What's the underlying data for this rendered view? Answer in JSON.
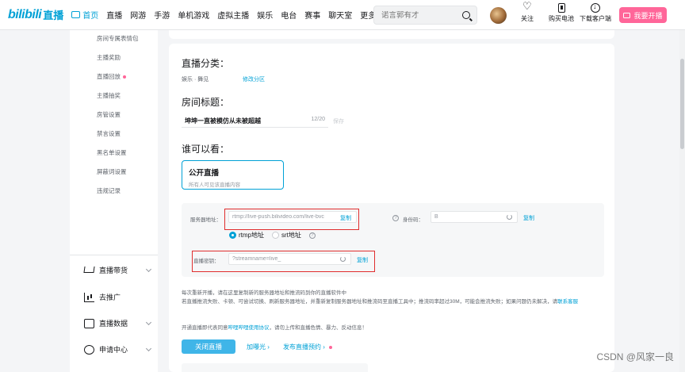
{
  "header": {
    "logo_mark": "bilibili",
    "logo_live": "直播",
    "nav": [
      "首页",
      "直播",
      "网游",
      "手游",
      "单机游戏",
      "虚拟主播",
      "娱乐",
      "电台",
      "赛事",
      "聊天室",
      "更多"
    ],
    "search_placeholder": "诺言郭有才",
    "actions": {
      "follow": "关注",
      "battery": "购买电池",
      "download": "下载客户端"
    },
    "open_live_label": "我要开播"
  },
  "sidebar": {
    "items": [
      "房间专属表情包",
      "主播奖励",
      "直播回放",
      "主播抽奖",
      "房管设置",
      "禁言设置",
      "黑名单设置",
      "屏蔽词设置",
      "违规记录"
    ],
    "groups": [
      "直播带货",
      "去推广",
      "直播数据",
      "申请中心"
    ]
  },
  "main": {
    "category_title": "直播分类：",
    "category_value": "娱乐 · 舞见",
    "category_edit": "修改分区",
    "room_title_label": "房间标题：",
    "room_title_value": "坤坤一直被模仿从未被超越",
    "room_title_count": "12/20",
    "room_title_save": "保存",
    "visibility_label": "谁可以看：",
    "visibility_card_title": "公开直播",
    "visibility_card_desc": "所有人可见该直播内容",
    "server_label": "服务器地址：",
    "server_value": "rtmp://live-push.bilivideo.com/live-bvc",
    "copy_label": "复制",
    "id_label": "身份码：",
    "id_value": "B",
    "protocol_options": [
      "rtmp地址",
      "srt地址"
    ],
    "key_label": "直播密钥：",
    "key_value": "?streamname=live_",
    "notice_1": "每次重新开播，请在这里复制新的服务器地址和推流码到你的直播软件中",
    "notice_2a": "若直播推流失败、卡顿、可尝试切换、刷新服务器地址，并重新复制服务器地址和推流码至直播工具中；推流码率超过30M，可能会推流失败；如果问题仍未解决，请",
    "notice_2b": "联系客服",
    "notice_3a": "开通直播即代表同意",
    "notice_3b": "哔哩哔哩使用协议",
    "notice_3c": "，请勿上传和直播色情、暴力、反动信息！",
    "close_button": "关闭直播",
    "boost_link": "加曝光",
    "schedule_link": "发布直播预约"
  },
  "watermark": "CSDN @风家一良",
  "colors": {
    "accent": "#00a1d6",
    "pink": "#ff6699",
    "highlight_border": "#e02e2e"
  }
}
